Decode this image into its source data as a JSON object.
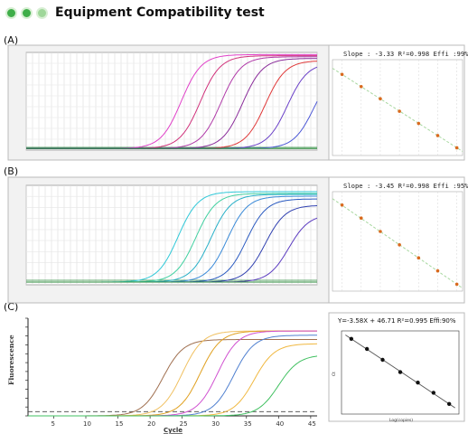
{
  "header": {
    "title": "Equipment Compatibility test",
    "dot_colors": [
      "#3fae49",
      "#3fae49",
      "#9fd79a"
    ]
  },
  "chart_data": [
    {
      "panel": "(A)",
      "type": "line",
      "subtype": "amplification",
      "x": [
        1,
        2,
        3,
        4,
        5,
        6,
        7,
        8,
        9,
        10,
        11,
        12,
        13,
        14,
        15,
        16,
        17,
        18,
        19,
        20,
        21,
        22,
        23,
        24,
        25,
        26,
        27,
        28,
        29,
        30,
        31,
        32,
        33,
        34,
        35,
        36,
        37,
        38,
        39,
        40,
        41,
        42,
        43,
        44,
        45,
        46,
        47
      ],
      "xlim": [
        1,
        47
      ],
      "series": [
        {
          "color": "#e040c8",
          "ct": 25.5,
          "plateau": 1.73
        },
        {
          "color": "#d0307a",
          "ct": 28.5,
          "plateau": 1.71
        },
        {
          "color": "#b03aa8",
          "ct": 31.8,
          "plateau": 1.69
        },
        {
          "color": "#8a2c9a",
          "ct": 35.2,
          "plateau": 1.66
        },
        {
          "color": "#e03838",
          "ct": 38.8,
          "plateau": 1.62
        },
        {
          "color": "#6a40c8",
          "ct": 42.3,
          "plateau": 1.58
        },
        {
          "color": "#4b57d6",
          "ct": 46.5,
          "plateau": 1.5
        },
        {
          "color": "#2a8a3a",
          "ct": null,
          "plateau": 0.08
        }
      ],
      "standard_curve": {
        "annotation": "Slope : -3.33 R²=0.998 Effi :99%",
        "type": "scatter",
        "x": [
          1,
          2,
          3,
          4,
          5,
          6,
          7
        ],
        "y": [
          22.0,
          25.3,
          28.6,
          32.0,
          35.3,
          38.6,
          41.9
        ],
        "point_color": "#d96a1e",
        "line_color": "#a8d8a0"
      }
    },
    {
      "panel": "(B)",
      "type": "line",
      "subtype": "amplification",
      "x": [
        1,
        2,
        3,
        4,
        5,
        6,
        7,
        8,
        9,
        10,
        11,
        12,
        13,
        14,
        15,
        16,
        17,
        18,
        19,
        20,
        21,
        22,
        23,
        24,
        25,
        26,
        27,
        28,
        29,
        30,
        31,
        32,
        33,
        34,
        35,
        36,
        37,
        38,
        39,
        40,
        41,
        42,
        43,
        44,
        45,
        46,
        47
      ],
      "xlim": [
        1,
        47
      ],
      "series": [
        {
          "color": "#30c8d8",
          "ct": 25.0,
          "plateau": 1.0
        },
        {
          "color": "#40d0a0",
          "ct": 27.8,
          "plateau": 0.98
        },
        {
          "color": "#28b0c8",
          "ct": 30.2,
          "plateau": 0.97
        },
        {
          "color": "#3a8ad8",
          "ct": 32.8,
          "plateau": 0.95
        },
        {
          "color": "#2a5ac0",
          "ct": 35.8,
          "plateau": 0.92
        },
        {
          "color": "#3040b0",
          "ct": 38.8,
          "plateau": 0.85
        },
        {
          "color": "#5a3ac0",
          "ct": 42.5,
          "plateau": 0.75
        },
        {
          "color": "#2a8a3a",
          "ct": null,
          "plateau": 0.02
        }
      ],
      "standard_curve": {
        "annotation": "Slope : -3.45 R²=0.998 Effi :95%",
        "type": "scatter",
        "x": [
          1,
          2,
          3,
          4,
          5,
          6,
          7
        ],
        "y": [
          21.5,
          24.9,
          28.4,
          31.9,
          35.3,
          38.7,
          42.2
        ],
        "point_color": "#d96a1e",
        "line_color": "#a8d8a0"
      }
    },
    {
      "panel": "(C)",
      "type": "line",
      "subtype": "amplification",
      "xlabel": "Cycle",
      "ylabel": "Fluorescence",
      "x_ticks": [
        "5",
        "10",
        "15",
        "20",
        "25",
        "30",
        "35",
        "40",
        "45"
      ],
      "xlim": [
        1,
        46
      ],
      "ylim": [
        0,
        1.15
      ],
      "threshold": 0.05,
      "series": [
        {
          "color": "#a07050",
          "ct": 22.0,
          "plateau": 0.9
        },
        {
          "color": "#f0c060",
          "ct": 25.0,
          "plateau": 1.0
        },
        {
          "color": "#e0a020",
          "ct": 27.8,
          "plateau": 1.0
        },
        {
          "color": "#d050d0",
          "ct": 30.5,
          "plateau": 1.0
        },
        {
          "color": "#5080d0",
          "ct": 33.0,
          "plateau": 0.95
        },
        {
          "color": "#f0b840",
          "ct": 36.2,
          "plateau": 0.85
        },
        {
          "color": "#40c060",
          "ct": 40.0,
          "plateau": 0.72
        }
      ],
      "standard_curve": {
        "annotation": "Y=-3.58X + 46.71 R²=0.995 Effi:90%",
        "type": "scatter",
        "xlabel": "Log(copies)",
        "ylabel": "Ct",
        "x": [
          0.5,
          1.3,
          2.1,
          3.0,
          3.9,
          4.7,
          5.5
        ],
        "y": [
          34.8,
          32.0,
          29.0,
          25.6,
          22.7,
          19.9,
          16.8
        ],
        "point_color": "#111111",
        "line_color": "#555555"
      }
    }
  ]
}
